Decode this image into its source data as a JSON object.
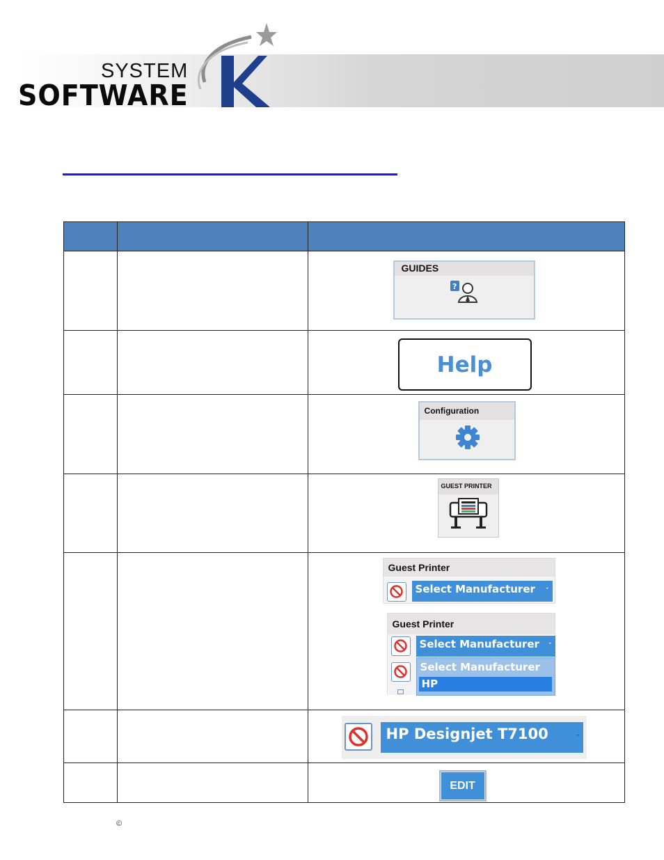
{
  "header": {
    "logo_line1": "SYSTEM",
    "logo_line2": "SOFTWARE",
    "logo_letter": "K",
    "logo_color": "#1f3f8c",
    "star_color": "#9a9a9a"
  },
  "title_link": {
    "text": "",
    "color": "#1a1ae6"
  },
  "table": {
    "header_color": "#4f81bd",
    "rows": [
      {
        "step": "",
        "description": "",
        "image": "guides-tile"
      },
      {
        "step": "",
        "description": "",
        "image": "help-button"
      },
      {
        "step": "",
        "description": "",
        "image": "configuration-tile"
      },
      {
        "step": "",
        "description": "",
        "image": "guest-printer-tile"
      },
      {
        "step": "",
        "description": "",
        "image": "guest-printer-select"
      },
      {
        "step": "",
        "description": "",
        "image": "printer-model-select"
      },
      {
        "step": "",
        "description": "",
        "image": "edit-button"
      }
    ]
  },
  "guides_tile": {
    "title": "GUIDES",
    "icon": "guides-person-help-icon"
  },
  "help_button": {
    "label": "Help"
  },
  "configuration_tile": {
    "title": "Configuration",
    "icon": "gear-icon"
  },
  "guest_printer_tile": {
    "title": "GUEST PRINTER",
    "icon": "printer-icon"
  },
  "guest_printer_panel": {
    "title": "Guest Printer",
    "select_value": "Select Manufacturer",
    "options": [
      "Select Manufacturer",
      "HP"
    ],
    "highlighted_option": "HP",
    "icon": "no-entry-icon"
  },
  "model_select": {
    "value": "HP Designjet T7100",
    "icon": "no-entry-icon"
  },
  "edit_button": {
    "label": "EDIT"
  },
  "footer": {
    "copyright": "©"
  }
}
